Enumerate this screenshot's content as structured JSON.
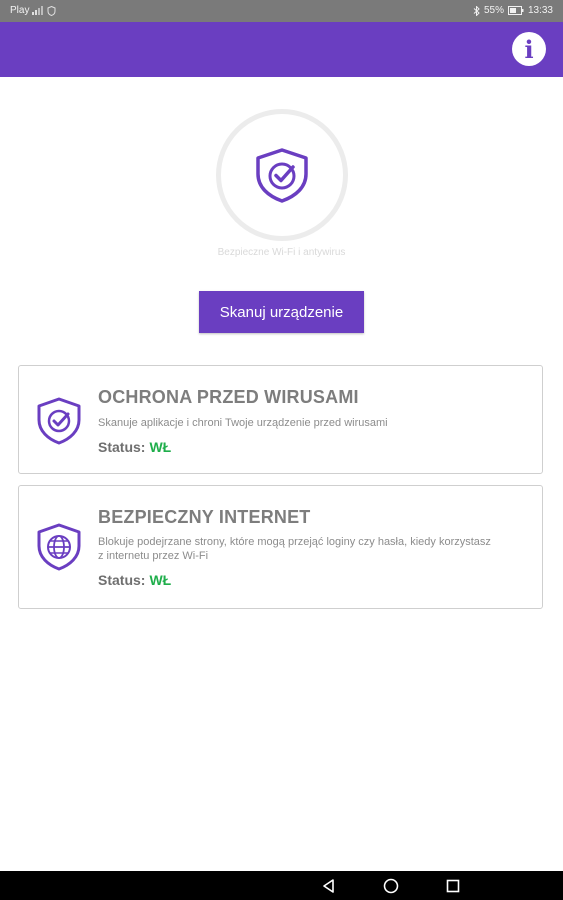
{
  "status_bar": {
    "carrier": "Play",
    "battery": "55%",
    "time": "13:33"
  },
  "app_bar": {
    "info_label": "i"
  },
  "hero": {
    "caption": "Bezpieczne Wi-Fi i antywirus"
  },
  "scan_button": {
    "label": "Skanuj urządzenie"
  },
  "cards": [
    {
      "title": "OCHRONA PRZED WIRUSAMI",
      "description": "Skanuje aplikacje i chroni Twoje urządzenie przed wirusami",
      "status_label": "Status:",
      "status_value": "WŁ"
    },
    {
      "title": "BEZPIECZNY INTERNET",
      "description": "Blokuje podejrzane strony, które mogą przejąć loginy czy hasła, kiedy korzystasz z internetu przez Wi-Fi",
      "status_label": "Status:",
      "status_value": "WŁ"
    }
  ],
  "colors": {
    "accent": "#6a3ec1",
    "status_on": "#1fae4b"
  },
  "icons": {
    "hero": "shield-check-icon",
    "card_1": "shield-check-icon",
    "card_2": "shield-globe-icon",
    "nav_back": "back-triangle-icon",
    "nav_home": "home-circle-icon",
    "nav_recent": "recent-square-icon"
  }
}
